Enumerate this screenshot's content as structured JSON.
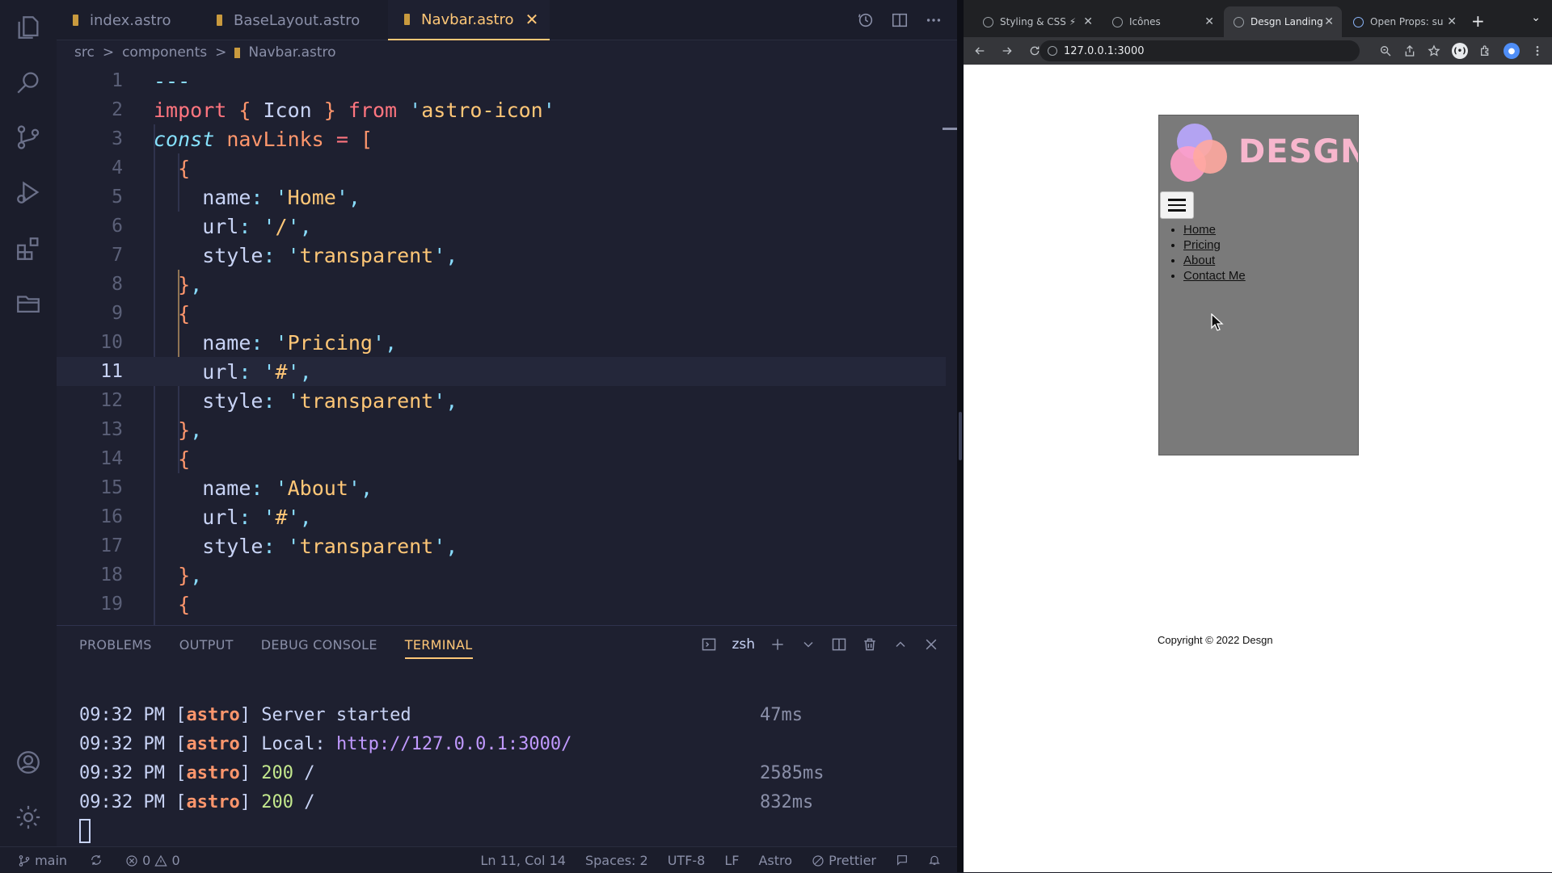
{
  "editor": {
    "tabs": [
      {
        "label": "index.astro"
      },
      {
        "label": "BaseLayout.astro"
      },
      {
        "label": "Navbar.astro"
      }
    ],
    "breadcrumb": [
      "src",
      "components",
      "Navbar.astro"
    ],
    "breadcrumb_sep": ">",
    "lines": [
      {
        "n": "1",
        "t": [
          [
            "punc",
            "---"
          ]
        ]
      },
      {
        "n": "2",
        "t": [
          [
            "kw",
            "import"
          ],
          [
            "var",
            " "
          ],
          [
            "brace",
            "{"
          ],
          [
            "var",
            " Icon "
          ],
          [
            "brace",
            "}"
          ],
          [
            "var",
            " "
          ],
          [
            "kw",
            "from"
          ],
          [
            "var",
            " "
          ],
          [
            "punc",
            "'"
          ],
          [
            "str",
            "astro-icon"
          ],
          [
            "punc",
            "'"
          ]
        ]
      },
      {
        "n": "3",
        "t": [
          [
            "kw2",
            "const"
          ],
          [
            "var",
            " "
          ],
          [
            "decl",
            "navLinks"
          ],
          [
            "var",
            " "
          ],
          [
            "kw",
            "="
          ],
          [
            "var",
            " "
          ],
          [
            "brace",
            "["
          ]
        ]
      },
      {
        "n": "4",
        "t": [
          [
            "var",
            "  "
          ],
          [
            "brace",
            "{"
          ]
        ]
      },
      {
        "n": "5",
        "t": [
          [
            "var",
            "    name"
          ],
          [
            "punc",
            ":"
          ],
          [
            "var",
            " "
          ],
          [
            "punc",
            "'"
          ],
          [
            "str",
            "Home"
          ],
          [
            "punc",
            "'"
          ],
          [
            "punc",
            ","
          ]
        ]
      },
      {
        "n": "6",
        "t": [
          [
            "var",
            "    url"
          ],
          [
            "punc",
            ":"
          ],
          [
            "var",
            " "
          ],
          [
            "punc",
            "'"
          ],
          [
            "str",
            "/"
          ],
          [
            "punc",
            "'"
          ],
          [
            "punc",
            ","
          ]
        ]
      },
      {
        "n": "7",
        "t": [
          [
            "var",
            "    style"
          ],
          [
            "punc",
            ":"
          ],
          [
            "var",
            " "
          ],
          [
            "punc",
            "'"
          ],
          [
            "str",
            "transparent"
          ],
          [
            "punc",
            "'"
          ],
          [
            "punc",
            ","
          ]
        ]
      },
      {
        "n": "8",
        "t": [
          [
            "var",
            "  "
          ],
          [
            "brace",
            "}"
          ],
          [
            "punc",
            ","
          ]
        ]
      },
      {
        "n": "9",
        "t": [
          [
            "var",
            "  "
          ],
          [
            "brace",
            "{"
          ]
        ]
      },
      {
        "n": "10",
        "t": [
          [
            "var",
            "    name"
          ],
          [
            "punc",
            ":"
          ],
          [
            "var",
            " "
          ],
          [
            "punc",
            "'"
          ],
          [
            "str",
            "Pricing"
          ],
          [
            "punc",
            "'"
          ],
          [
            "punc",
            ","
          ]
        ]
      },
      {
        "n": "11",
        "t": [
          [
            "var",
            "    url"
          ],
          [
            "punc",
            ":"
          ],
          [
            "var",
            " "
          ],
          [
            "punc",
            "'"
          ],
          [
            "str",
            "#"
          ],
          [
            "punc",
            "'"
          ],
          [
            "punc",
            ","
          ]
        ]
      },
      {
        "n": "12",
        "t": [
          [
            "var",
            "    style"
          ],
          [
            "punc",
            ":"
          ],
          [
            "var",
            " "
          ],
          [
            "punc",
            "'"
          ],
          [
            "str",
            "transparent"
          ],
          [
            "punc",
            "'"
          ],
          [
            "punc",
            ","
          ]
        ]
      },
      {
        "n": "13",
        "t": [
          [
            "var",
            "  "
          ],
          [
            "brace",
            "}"
          ],
          [
            "punc",
            ","
          ]
        ]
      },
      {
        "n": "14",
        "t": [
          [
            "var",
            "  "
          ],
          [
            "brace",
            "{"
          ]
        ]
      },
      {
        "n": "15",
        "t": [
          [
            "var",
            "    name"
          ],
          [
            "punc",
            ":"
          ],
          [
            "var",
            " "
          ],
          [
            "punc",
            "'"
          ],
          [
            "str",
            "About"
          ],
          [
            "punc",
            "'"
          ],
          [
            "punc",
            ","
          ]
        ]
      },
      {
        "n": "16",
        "t": [
          [
            "var",
            "    url"
          ],
          [
            "punc",
            ":"
          ],
          [
            "var",
            " "
          ],
          [
            "punc",
            "'"
          ],
          [
            "str",
            "#"
          ],
          [
            "punc",
            "'"
          ],
          [
            "punc",
            ","
          ]
        ]
      },
      {
        "n": "17",
        "t": [
          [
            "var",
            "    style"
          ],
          [
            "punc",
            ":"
          ],
          [
            "var",
            " "
          ],
          [
            "punc",
            "'"
          ],
          [
            "str",
            "transparent"
          ],
          [
            "punc",
            "'"
          ],
          [
            "punc",
            ","
          ]
        ]
      },
      {
        "n": "18",
        "t": [
          [
            "var",
            "  "
          ],
          [
            "brace",
            "}"
          ],
          [
            "punc",
            ","
          ]
        ]
      },
      {
        "n": "19",
        "t": [
          [
            "var",
            "  "
          ],
          [
            "brace",
            "{"
          ]
        ]
      }
    ],
    "current_line": "11"
  },
  "panel": {
    "tabs": [
      "PROBLEMS",
      "OUTPUT",
      "DEBUG CONSOLE",
      "TERMINAL"
    ],
    "shell": "zsh",
    "terminal": [
      {
        "time": "09:32 PM",
        "tag": "astro",
        "msg": "Server started",
        "kind": "plain",
        "dur": "47ms"
      },
      {
        "time": "09:32 PM",
        "tag": "astro",
        "label": "Local:",
        "msg": "http://127.0.0.1:3000/",
        "kind": "url",
        "dur": ""
      },
      {
        "time": "09:32 PM",
        "tag": "astro",
        "code": "200",
        "msg": "/",
        "kind": "status",
        "dur": "2585ms"
      },
      {
        "time": "09:32 PM",
        "tag": "astro",
        "code": "200",
        "msg": "/",
        "kind": "status",
        "dur": "832ms"
      }
    ]
  },
  "statusbar": {
    "branch": "main",
    "errors": "0",
    "warnings": "0",
    "position": "Ln 11, Col 14",
    "spaces": "Spaces: 2",
    "encoding": "UTF-8",
    "eol": "LF",
    "language": "Astro",
    "formatter": "Prettier"
  },
  "browser": {
    "tabs": [
      {
        "label": "Styling & CSS ⚡"
      },
      {
        "label": "Icônes"
      },
      {
        "label": "Desgn Landing"
      },
      {
        "label": "Open Props: su"
      }
    ],
    "url": "127.0.0.1:3000",
    "site": {
      "logo_text": "DESGN",
      "links": [
        "Home",
        "Pricing",
        "About",
        "Contact Me"
      ],
      "copyright": "Copyright © 2022 Desgn",
      "colors": {
        "nav_bg": "#7a7a7a",
        "logo": "#f7b6cd"
      }
    }
  }
}
